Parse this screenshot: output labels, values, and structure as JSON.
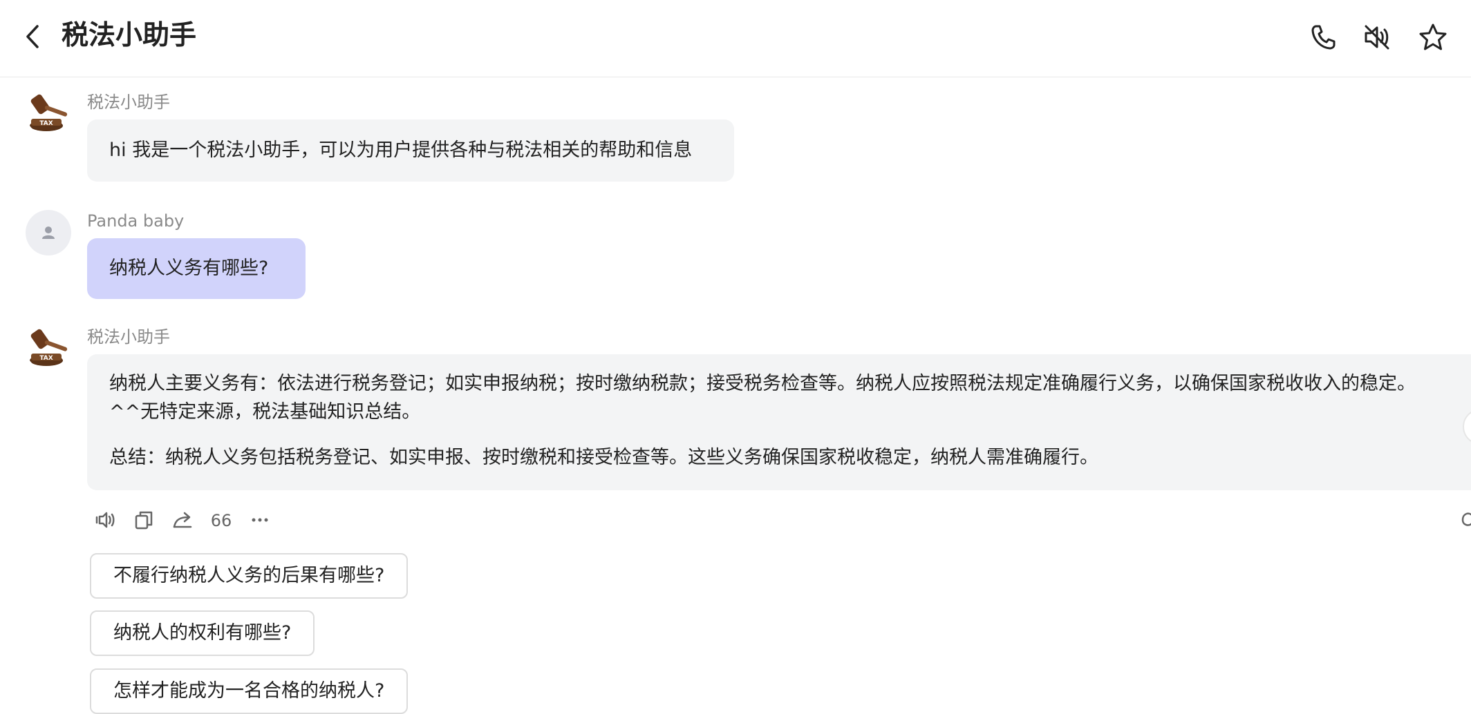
{
  "header": {
    "title": "税法小助手",
    "icons": [
      "back-arrow-icon",
      "phone-icon",
      "speaker-mute-icon",
      "star-icon"
    ]
  },
  "messages": [
    {
      "sender": "税法小助手",
      "avatar": "gavel-tax-avatar",
      "text": "hi 我是一个税法小助手，可以为用户提供各种与税法相关的帮助和信息"
    },
    {
      "sender": "Panda baby",
      "avatar": "default-user-avatar",
      "text": "纳税人义务有哪些?"
    },
    {
      "sender": "税法小助手",
      "avatar": "gavel-tax-avatar",
      "paragraphs": [
        "纳税人主要义务有：依法进行税务登记；如实申报纳税；按时缴纳税款；接受税务检查等。纳税人应按照税法规定准确履行义务，以确保国家税收收入的稳定。",
        "^^无特定来源，税法基础知识总结。",
        "总结：纳税人义务包括税务登记、如实申报、按时缴税和接受检查等。这些义务确保国家税收稳定，纳税人需准确履行。"
      ]
    }
  ],
  "actions": [
    "speaker-icon",
    "copy-icon",
    "share-icon",
    "quote-icon",
    "more-icon",
    "regenerate-icon"
  ],
  "avatar_label": "TAX",
  "suggestions": [
    "不履行纳税人义务的后果有哪些?",
    "纳税人的权利有哪些?",
    "怎样才能成为一名合格的纳税人?"
  ],
  "colors": {
    "user_bubble": "#d1d3fb",
    "bot_bubble": "#f3f4f5",
    "sender_text": "#8a8a8a"
  }
}
